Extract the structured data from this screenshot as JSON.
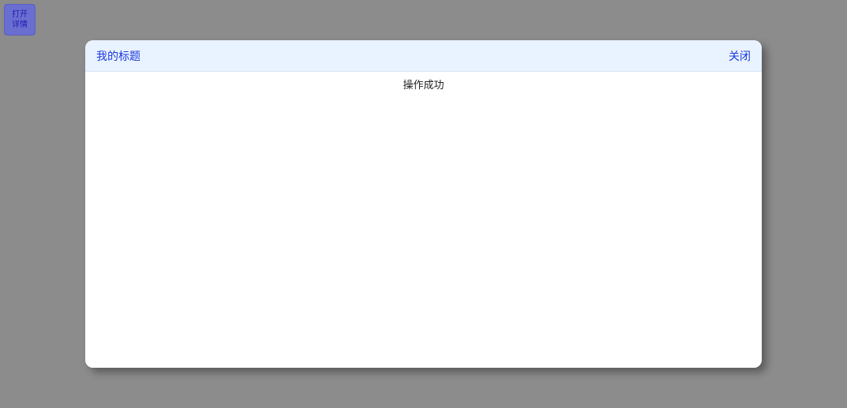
{
  "trigger": {
    "line1": "打开",
    "line2": "详情"
  },
  "modal": {
    "title": "我的标题",
    "close_label": "关闭",
    "message": "操作成功"
  }
}
